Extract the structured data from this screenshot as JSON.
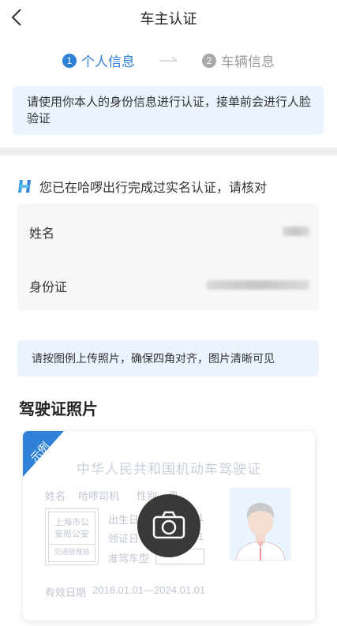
{
  "navbar": {
    "title": "车主认证"
  },
  "steps": {
    "step1": {
      "number": "1",
      "label": "个人信息"
    },
    "step2": {
      "number": "2",
      "label": "车辆信息"
    }
  },
  "notice_top": "请使用你本人的身份信息进行认证，接单前会进行人脸验证",
  "verified_text": "您已在哈啰出行完成过实名认证，请核对",
  "info": {
    "name_label": "姓名",
    "id_label": "身份证"
  },
  "notice_upload": "请按图例上传照片，确保四角对齐，图片清晰可见",
  "section_title": "驾驶证照片",
  "license_sample": {
    "ribbon": "示例",
    "title": "中华人民共和国机动车驾驶证",
    "name_label": "姓名",
    "name_value": "哈啰司机",
    "sex_label": "性别",
    "sex_value": "男",
    "stamp_line1": "上海市公",
    "stamp_line2": "安局公安",
    "stamp_line3": "交通管理局",
    "birth_label": "出生日",
    "birth_tail": "1",
    "issue_label": "领证日",
    "issue_tail": "1",
    "class_label": "准驾车型",
    "valid_label": "有效日期",
    "valid_value": "2018.01.01—2024.01.01"
  },
  "colors": {
    "accent": "#2f80d7",
    "notice_bg": "#eaf4fe",
    "card_bg": "#f7f7f8"
  },
  "icons": {
    "back": "chevron-left-icon",
    "brand": "hellobike-h-icon",
    "camera": "camera-icon"
  }
}
